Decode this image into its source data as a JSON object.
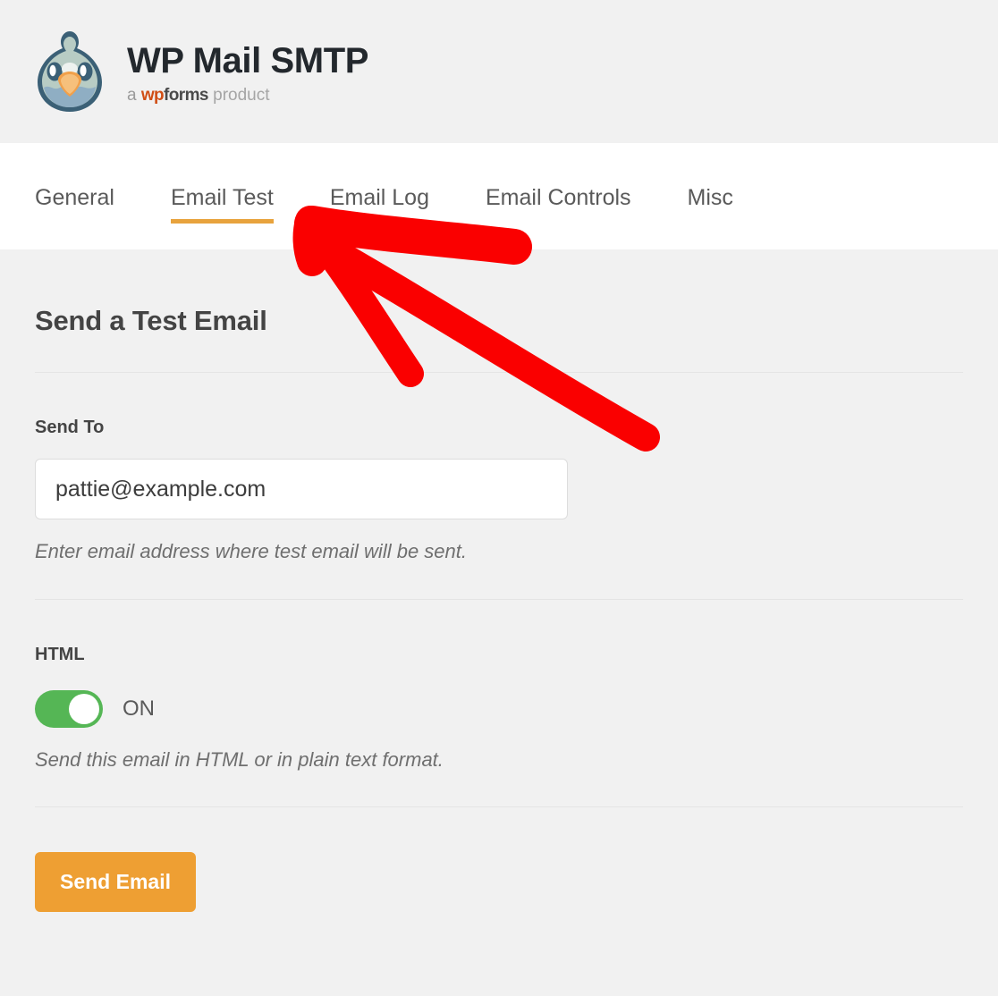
{
  "header": {
    "logo_icon": "wp-mail-smtp-bird-logo",
    "title": "WP Mail SMTP",
    "tagline": {
      "prefix": "a",
      "brand_wp": "wp",
      "brand_forms": "forms",
      "suffix": "product"
    }
  },
  "tabs": [
    {
      "label": "General",
      "active": false
    },
    {
      "label": "Email Test",
      "active": true
    },
    {
      "label": "Email Log",
      "active": false
    },
    {
      "label": "Email Controls",
      "active": false
    },
    {
      "label": "Misc",
      "active": false
    }
  ],
  "main": {
    "page_title": "Send a Test Email",
    "send_to": {
      "label": "Send To",
      "value": "pattie@example.com",
      "placeholder": "pattie@example.com",
      "description": "Enter email address where test email will be sent."
    },
    "html_toggle": {
      "label": "HTML",
      "state": "ON",
      "checked": true,
      "description": "Send this email in HTML or in plain text format."
    },
    "submit_label": "Send Email"
  },
  "annotation": {
    "type": "red-arrow",
    "points_to": "Email Test",
    "color": "#fa0000"
  },
  "colors": {
    "page_background": "#f1f1f1",
    "tabbar_background": "#ffffff",
    "accent_orange": "#e8a33d",
    "button_orange": "#ee9f33",
    "toggle_green": "#55b655",
    "annotation_red": "#fa0000",
    "brand_rust": "#d04e15"
  }
}
